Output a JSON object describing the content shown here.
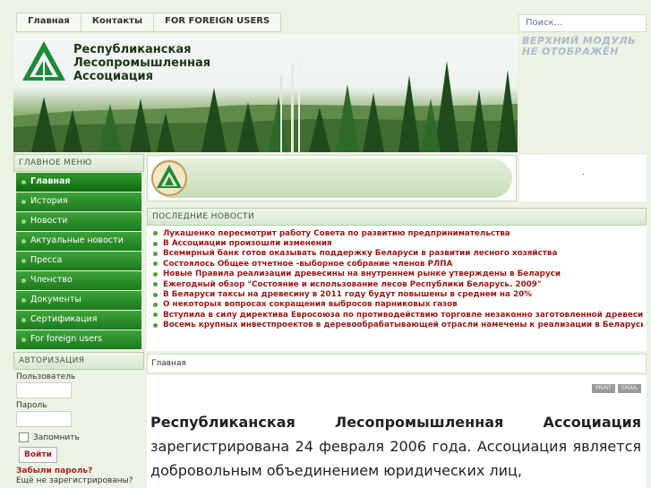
{
  "top_nav": [
    {
      "label": "Главная"
    },
    {
      "label": "Контакты"
    },
    {
      "label": "FOR FOREIGN USERS"
    }
  ],
  "search": {
    "placeholder": "Поиск..."
  },
  "banner": {
    "logo_lines": [
      "Республиканская",
      "Лесопромышленная",
      "Ассоциация"
    ]
  },
  "top_module": {
    "message": "ВЕРХНИЙ МОДУЛЬ НЕ ОТОБРАЖЁН"
  },
  "main_menu": {
    "title": "ГЛАВНОЕ МЕНЮ",
    "items": [
      {
        "label": "Главная"
      },
      {
        "label": "История"
      },
      {
        "label": "Новости"
      },
      {
        "label": "Актуальные новости"
      },
      {
        "label": "Пресса"
      },
      {
        "label": "Членство"
      },
      {
        "label": "Документы"
      },
      {
        "label": "Сертификация"
      },
      {
        "label": "For foreign users"
      }
    ]
  },
  "auth": {
    "title": "АВТОРИЗАЦИЯ",
    "username_label": "Пользователь",
    "password_label": "Пароль",
    "remember_label": "Запомнить",
    "login_button": "Войти",
    "forgot_link": "Забыли пароль?",
    "register_text": "Ещё не зарегистрированы?"
  },
  "side_dot": ".",
  "latest_news": {
    "title": "ПОСЛЕДНИЕ НОВОСТИ",
    "items": [
      "Лукашенко пересмотрит работу Совета по развитию предпринимательства",
      "В Ассоциации произошли изменения",
      "Всемирный банк готов оказывать поддержку Беларуси в развитии лесного хозяйства",
      "Состоялось Общее отчетное -выборное собрание членов РЛПА",
      "Новые Правила реализации древесины на внутреннем рынке утверждены в Беларуси",
      "Ежегодный обзор \"Состояние и использование лесов Республики Беларусь. 2009\"",
      "В Беларуси таксы на древесину в 2011 году будут повышены в среднем на 20%",
      "О некоторых вопросах сокращения выбросов парниковых газов",
      "Вступила в силу директива Евросоюза по противодействию торговле незаконно заготовленной древесиной",
      "Восемь крупных инвестпроектов в деревообрабатывающей отрасли намечены к реализации в Беларуси"
    ]
  },
  "breadcrumb": "Главная",
  "content": {
    "icons": [
      "print-icon",
      "email-icon"
    ],
    "print_label": "PRINT",
    "email_label": "EMAIL",
    "title": "Республиканская Лесопромышленная Ассоциация",
    "body": "зарегистрирована 24 февраля 2006 года. Ассоциация является добровольным объединением юридических лиц,"
  }
}
